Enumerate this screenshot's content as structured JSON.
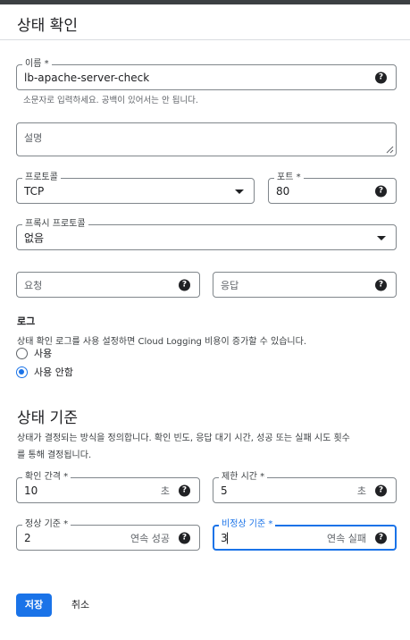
{
  "header": {
    "title": "상태 확인"
  },
  "name": {
    "label": "이름 *",
    "value": "lb-apache-server-check",
    "hint": "소문자로 입력하세요. 공백이 있어서는 안 됩니다."
  },
  "description": {
    "placeholder": "설명"
  },
  "protocol": {
    "label": "프로토콜",
    "value": "TCP"
  },
  "port": {
    "label": "포트 *",
    "value": "80"
  },
  "proxy_protocol": {
    "label": "프록시 프로토콜",
    "value": "없음"
  },
  "request": {
    "placeholder": "요청"
  },
  "response": {
    "placeholder": "응답"
  },
  "logs": {
    "title": "로그",
    "description": "상태 확인 로그를 사용 설정하면 Cloud Logging 비용이 증가할 수 있습니다.",
    "options": [
      {
        "label": "사용",
        "checked": false
      },
      {
        "label": "사용 안함",
        "checked": true
      }
    ]
  },
  "criteria": {
    "title": "상태 기준",
    "description_line1": "상태가 결정되는 방식을 정의합니다. 확인 빈도, 응답 대기 시간, 성공 또는 실패 시도 횟수",
    "description_line2": "를 통해 결정됩니다.",
    "check_interval": {
      "label": "확인 간격 *",
      "value": "10",
      "suffix": "초"
    },
    "timeout": {
      "label": "제한 시간 *",
      "value": "5",
      "suffix": "초"
    },
    "healthy_threshold": {
      "label": "정상 기준 *",
      "value": "2",
      "suffix": "연속 성공"
    },
    "unhealthy_threshold": {
      "label": "비정상 기준 *",
      "value": "3",
      "suffix": "연속 실패"
    }
  },
  "actions": {
    "save": "저장",
    "cancel": "취소"
  },
  "icons": {
    "help": "?",
    "help_name": "help-icon",
    "dropdown_name": "dropdown-arrow-icon"
  },
  "colors": {
    "accent": "#1a73e8",
    "text": "#202124",
    "border": "#80868b"
  }
}
